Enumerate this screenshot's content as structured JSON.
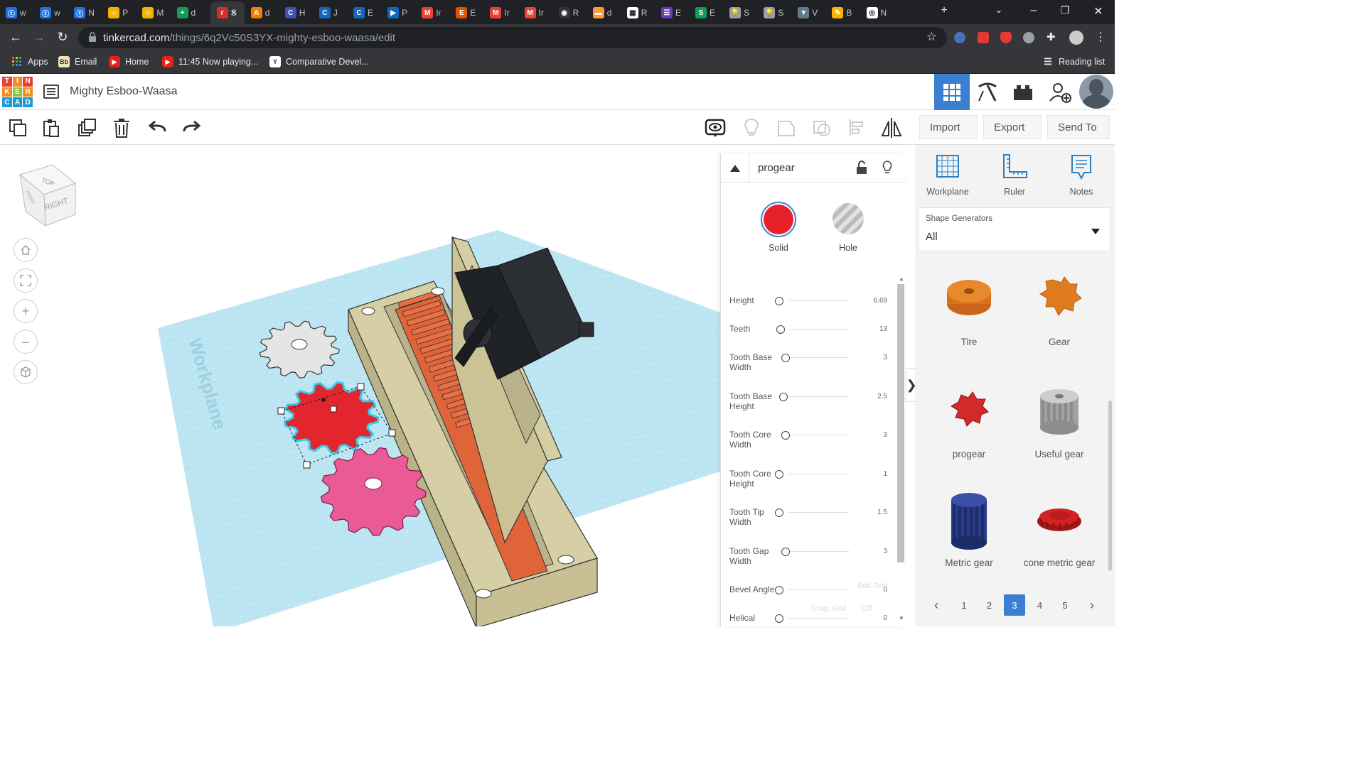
{
  "browser": {
    "tabs": [
      {
        "letter": "w",
        "color": "#1a73e8",
        "fav": "ⓣ"
      },
      {
        "letter": "w",
        "color": "#1a73e8",
        "fav": "ⓣ"
      },
      {
        "letter": "N",
        "color": "#1a73e8",
        "fav": "ⓣ"
      },
      {
        "letter": "P",
        "color": "#f4b400",
        "fav": "☺"
      },
      {
        "letter": "M",
        "color": "#f4b400",
        "fav": "☺"
      },
      {
        "letter": "d",
        "color": "#0f9d58",
        "fav": "+"
      },
      {
        "letter": "S",
        "color": "#d32f2f",
        "fav": "r"
      },
      {
        "letter": "d",
        "color": "#f57c00",
        "fav": "A"
      },
      {
        "letter": "H",
        "color": "#3f51b5",
        "fav": "C"
      },
      {
        "letter": "J",
        "color": "#1565c0",
        "fav": "C"
      },
      {
        "letter": "E",
        "color": "#1565c0",
        "fav": "C"
      },
      {
        "letter": "P",
        "color": "#1565c0",
        "fav": "▶"
      },
      {
        "letter": "Ir",
        "color": "#ea4335",
        "fav": "M"
      },
      {
        "letter": "E",
        "color": "#e65100",
        "fav": "E"
      },
      {
        "letter": "Ir",
        "color": "#ea4335",
        "fav": "M"
      },
      {
        "letter": "Ir",
        "color": "#ea4335",
        "fav": "M"
      },
      {
        "letter": "R",
        "color": "#333333",
        "fav": "◉"
      },
      {
        "letter": "d",
        "color": "#ff9933",
        "fav": "▬"
      },
      {
        "letter": "R",
        "color": "#ffffff",
        "fav": "▦"
      },
      {
        "letter": "E",
        "color": "#673ab7",
        "fav": "☰"
      },
      {
        "letter": "E",
        "color": "#0f9d58",
        "fav": "S"
      },
      {
        "letter": "S",
        "color": "#9e9e9e",
        "fav": "💡"
      },
      {
        "letter": "S",
        "color": "#9e9e9e",
        "fav": "💡"
      },
      {
        "letter": "V",
        "color": "#607d8b",
        "fav": "▼"
      },
      {
        "letter": "B",
        "color": "#ffb300",
        "fav": "✎"
      },
      {
        "letter": "N",
        "color": "#ffffff",
        "fav": "◎"
      }
    ],
    "url_host": "tinkercad.com",
    "url_path": "/things/6q2Vc50S3YX-mighty-esboo-waasa/edit",
    "bookmarks": [
      {
        "label": "Apps",
        "icon": "apps-grid-icon"
      },
      {
        "label": "Email",
        "icon": "bb-icon"
      },
      {
        "label": "Home",
        "icon": "youtube-icon"
      },
      {
        "label": "11:45 Now playing...",
        "icon": "youtube-icon"
      },
      {
        "label": "Comparative Devel...",
        "icon": "document-icon"
      }
    ],
    "reading_list": "Reading list"
  },
  "app": {
    "logo_letters": [
      "T",
      "I",
      "N",
      "K",
      "E",
      "R",
      "C",
      "A",
      "D"
    ],
    "title": "Mighty Esboo-Waasa"
  },
  "toolbar": {
    "import_label": "Import",
    "export_label": "Export",
    "sendto_label": "Send To"
  },
  "viewcube": {
    "top": "TOP",
    "right": "RIGHT",
    "front": "FRONT"
  },
  "canvas": {
    "workplane_label": "Workplane"
  },
  "inspector": {
    "shape_name": "progear",
    "solid_label": "Solid",
    "hole_label": "Hole",
    "params": [
      {
        "label": "Height",
        "value": "6.69",
        "level": 0.0
      },
      {
        "label": "Teeth",
        "value": "13",
        "level": 0.02
      },
      {
        "label": "Tooth Base Width",
        "value": "3",
        "level": 0.1
      },
      {
        "label": "Tooth Base Height",
        "value": "2.5",
        "level": 0.07
      },
      {
        "label": "Tooth Core Width",
        "value": "3",
        "level": 0.1
      },
      {
        "label": "Tooth Core Height",
        "value": "1",
        "level": 0.0
      },
      {
        "label": "Tooth Tip Width",
        "value": "1.5",
        "level": 0.0
      },
      {
        "label": "Tooth Gap Width",
        "value": "3",
        "level": 0.1
      },
      {
        "label": "Bevel Angle",
        "value": "0",
        "level": 0.0
      },
      {
        "label": "Helical",
        "value": "0",
        "level": 0.0
      }
    ],
    "edit_grid": "Edit Grid",
    "snap_grid": "Snap Grid",
    "snap_value": "Off"
  },
  "shapes_panel": {
    "workplane_label": "Workplane",
    "ruler_label": "Ruler",
    "notes_label": "Notes",
    "generators_caption": "Shape Generators",
    "generators_value": "All",
    "shapes": [
      {
        "name": "Tire",
        "color": "#e07b1f"
      },
      {
        "name": "Gear",
        "color": "#e07b1f"
      },
      {
        "name": "progear",
        "color": "#d22a2a"
      },
      {
        "name": "Useful gear",
        "color": "#9a9a9a"
      },
      {
        "name": "Metric gear",
        "color": "#23357a"
      },
      {
        "name": "cone metric gear",
        "color": "#c81e1e"
      }
    ],
    "pages": [
      "1",
      "2",
      "3",
      "4",
      "5"
    ],
    "current_page": "3"
  },
  "colors": {
    "accent": "#3b7fd1",
    "solid": "#e8202a",
    "selected_gear": "#e3262d",
    "pink_gear": "#ea5a96",
    "white_gear": "#e5e5e5",
    "workplane": "#bfe6f3",
    "base": "#d6cfa5"
  }
}
